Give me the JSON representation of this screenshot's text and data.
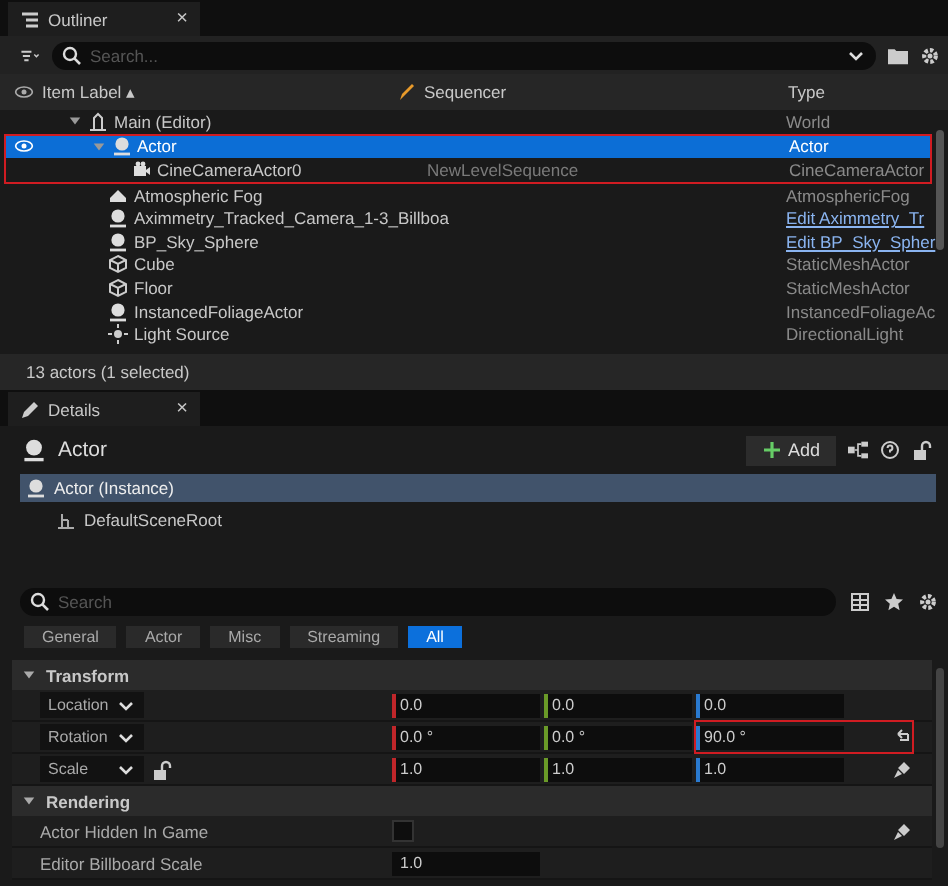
{
  "outliner": {
    "tab": {
      "title": "Outliner",
      "close": "×"
    },
    "search": {
      "placeholder": "Search..."
    },
    "columns": [
      "Item Label ▴",
      "Sequencer",
      "Type"
    ],
    "tree": [
      {
        "label": "Main (Editor)",
        "kind": "world",
        "type": "World",
        "expanded": true,
        "selected": false,
        "children": [
          {
            "label": "Actor",
            "kind": "actor",
            "type": "Actor",
            "expanded": true,
            "selected": true,
            "visible": true,
            "children": [
              {
                "label": "CineCameraActor0",
                "kind": "camera",
                "sequencer": "NewLevelSequence",
                "type": "CineCameraActor",
                "selected": false
              }
            ]
          },
          {
            "label": "Atmospheric Fog",
            "kind": "fog",
            "type": "AtmosphericFog",
            "selected": false
          },
          {
            "label": "Aximmetry_Tracked_Camera_1-3_Billboa",
            "kind": "actor",
            "edit_link": "Edit Aximmetry_Tr",
            "selected": false
          },
          {
            "label": "BP_Sky_Sphere",
            "kind": "actor",
            "edit_link": "Edit BP_Sky_Spher",
            "selected": false
          },
          {
            "label": "Cube",
            "kind": "mesh",
            "type": "StaticMeshActor",
            "selected": false
          },
          {
            "label": "Floor",
            "kind": "mesh",
            "type": "StaticMeshActor",
            "selected": false
          },
          {
            "label": "InstancedFoliageActor",
            "kind": "actor",
            "type": "InstancedFoliageAc",
            "selected": false
          },
          {
            "label": "Light Source",
            "kind": "light",
            "type": "DirectionalLight",
            "selected": false
          }
        ]
      }
    ],
    "status": "13 actors (1 selected)"
  },
  "details": {
    "tab": {
      "title": "Details",
      "close": "×"
    },
    "actor_name": "Actor",
    "add_button": "Add",
    "components": [
      {
        "label": "Actor (Instance)",
        "selected": true,
        "children": [
          {
            "label": "DefaultSceneRoot",
            "selected": false
          }
        ]
      }
    ],
    "search": {
      "placeholder": "Search"
    },
    "filters": [
      {
        "label": "General",
        "selected": false
      },
      {
        "label": "Actor",
        "selected": false
      },
      {
        "label": "Misc",
        "selected": false
      },
      {
        "label": "Streaming",
        "selected": false
      },
      {
        "label": "All",
        "selected": true
      }
    ],
    "sections": [
      {
        "title": "Transform",
        "expanded": true,
        "rows": [
          {
            "kind": "vector",
            "label": "Location",
            "values": [
              "0.0",
              "0.0",
              "0.0"
            ]
          },
          {
            "kind": "vector",
            "label": "Rotation",
            "values": [
              "0.0 °",
              "0.0 °",
              "90.0 °"
            ],
            "reset": true
          },
          {
            "kind": "vector",
            "label": "Scale",
            "values": [
              "1.0",
              "1.0",
              "1.0"
            ],
            "lock": true,
            "brush": true
          }
        ]
      },
      {
        "title": "Rendering",
        "expanded": true,
        "rows": [
          {
            "kind": "checkbox",
            "label": "Actor Hidden In Game",
            "checked": false,
            "brush": true
          },
          {
            "kind": "number",
            "label": "Editor Billboard Scale",
            "value": "1.0"
          }
        ]
      }
    ]
  }
}
